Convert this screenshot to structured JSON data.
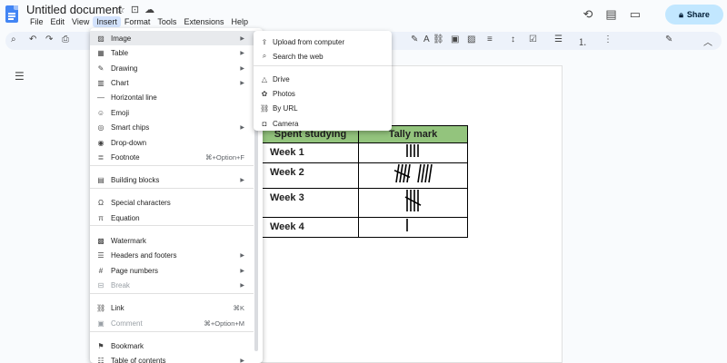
{
  "app": {
    "doc_title": "Untitled document",
    "share_label": "Share"
  },
  "menubar": [
    "File",
    "Edit",
    "View",
    "Insert",
    "Format",
    "Tools",
    "Extensions",
    "Help"
  ],
  "insert_menu": [
    {
      "label": "Image",
      "icon": "image-icon",
      "submenu": true,
      "highlight": true
    },
    {
      "label": "Table",
      "icon": "table-icon",
      "submenu": true
    },
    {
      "label": "Drawing",
      "icon": "drawing-icon",
      "submenu": true
    },
    {
      "label": "Chart",
      "icon": "chart-icon",
      "submenu": true
    },
    {
      "label": "Horizontal line",
      "icon": "horizontal-line-icon"
    },
    {
      "label": "Emoji",
      "icon": "emoji-icon"
    },
    {
      "label": "Smart chips",
      "icon": "smart-chips-icon",
      "submenu": true
    },
    {
      "label": "Drop-down",
      "icon": "dropdown-icon"
    },
    {
      "label": "Footnote",
      "icon": "footnote-icon",
      "shortcut": "⌘+Option+F"
    },
    {
      "label": "Building blocks",
      "icon": "building-blocks-icon",
      "submenu": true
    },
    {
      "label": "Special characters",
      "icon": "special-characters-icon"
    },
    {
      "label": "Equation",
      "icon": "equation-icon"
    },
    {
      "label": "Watermark",
      "icon": "watermark-icon"
    },
    {
      "label": "Headers and footers",
      "icon": "headers-footers-icon",
      "submenu": true
    },
    {
      "label": "Page numbers",
      "icon": "page-numbers-icon",
      "submenu": true
    },
    {
      "label": "Break",
      "icon": "break-icon",
      "submenu": true,
      "disabled": true
    },
    {
      "label": "Link",
      "icon": "link-icon",
      "shortcut": "⌘K"
    },
    {
      "label": "Comment",
      "icon": "comment-icon",
      "shortcut": "⌘+Option+M",
      "disabled": true
    },
    {
      "label": "Bookmark",
      "icon": "bookmark-icon"
    },
    {
      "label": "Table of contents",
      "icon": "table-of-contents-icon",
      "submenu": true
    }
  ],
  "image_submenu": [
    {
      "label": "Upload from computer",
      "icon": "upload-icon"
    },
    {
      "label": "Search the web",
      "icon": "search-icon"
    },
    {
      "label": "Drive",
      "icon": "drive-icon"
    },
    {
      "label": "Photos",
      "icon": "photos-icon"
    },
    {
      "label": "By URL",
      "icon": "link-icon"
    },
    {
      "label": "Camera",
      "icon": "camera-icon"
    }
  ],
  "table": {
    "headers": [
      "Spent studying",
      "Tally mark"
    ],
    "rows": [
      {
        "week": "Week 1",
        "tally": 4
      },
      {
        "week": "Week 2",
        "tally": 9
      },
      {
        "week": "Week 3",
        "tally": 5
      },
      {
        "week": "Week 4",
        "tally": 1
      }
    ]
  },
  "colors": {
    "header_bg": "#93c47d",
    "share_bg": "#c2e7ff",
    "menu_highlight": "#e8eaed"
  }
}
